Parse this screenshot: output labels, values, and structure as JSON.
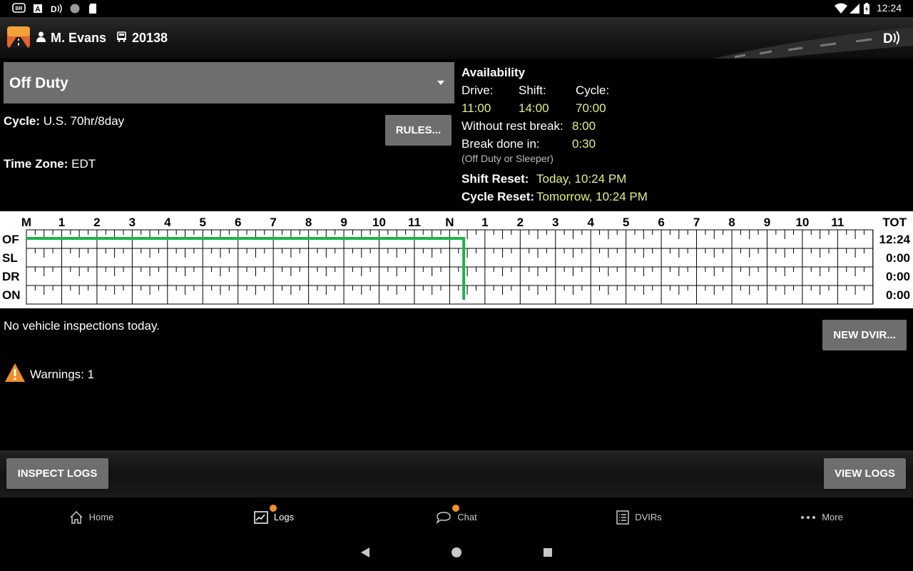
{
  "status_bar": {
    "time": "12:24"
  },
  "header": {
    "driver": "M. Evans",
    "truck": "20138"
  },
  "duty_status": {
    "selected": "Off Duty"
  },
  "cycle": {
    "label": "Cycle:",
    "value": "U.S. 70hr/8day"
  },
  "timezone": {
    "label": "Time Zone:",
    "value": "EDT"
  },
  "rules_button": "RULES...",
  "availability": {
    "title": "Availability",
    "drive_label": "Drive:",
    "drive_value": "11:00",
    "shift_label": "Shift:",
    "shift_value": "14:00",
    "cycle_label": "Cycle:",
    "cycle_value": "70:00",
    "without_break_label": "Without rest break:",
    "without_break_value": "8:00",
    "break_done_label": "Break done in:",
    "break_done_value": "0:30",
    "break_note": "(Off Duty or Sleeper)",
    "shift_reset_label": "Shift Reset:",
    "shift_reset_value": "Today, 10:24 PM",
    "cycle_reset_label": "Cycle Reset:",
    "cycle_reset_value": "Tomorrow, 10:24 PM"
  },
  "log_grid": {
    "hour_labels": [
      "M",
      "1",
      "2",
      "3",
      "4",
      "5",
      "6",
      "7",
      "8",
      "9",
      "10",
      "11",
      "N",
      "1",
      "2",
      "3",
      "4",
      "5",
      "6",
      "7",
      "8",
      "9",
      "10",
      "11"
    ],
    "total_label": "TOT",
    "rows": [
      {
        "label": "OF",
        "total": "12:24"
      },
      {
        "label": "SL",
        "total": "0:00"
      },
      {
        "label": "DR",
        "total": "0:00"
      },
      {
        "label": "ON",
        "total": "0:00"
      }
    ],
    "current_status_row": 0,
    "current_hour": 12.4,
    "line_color": "#1db34a"
  },
  "inspections": {
    "message": "No vehicle inspections today."
  },
  "new_dvir_button": "NEW DVIR...",
  "warnings": {
    "text": "Warnings: 1",
    "color": "#f0902a"
  },
  "inspect_logs_button": "INSPECT LOGS",
  "view_logs_button": "VIEW LOGS",
  "tabs": [
    {
      "label": "Home"
    },
    {
      "label": "Logs"
    },
    {
      "label": "Chat"
    },
    {
      "label": "DVIRs"
    },
    {
      "label": "More"
    }
  ],
  "accent_color": "#f0902a"
}
